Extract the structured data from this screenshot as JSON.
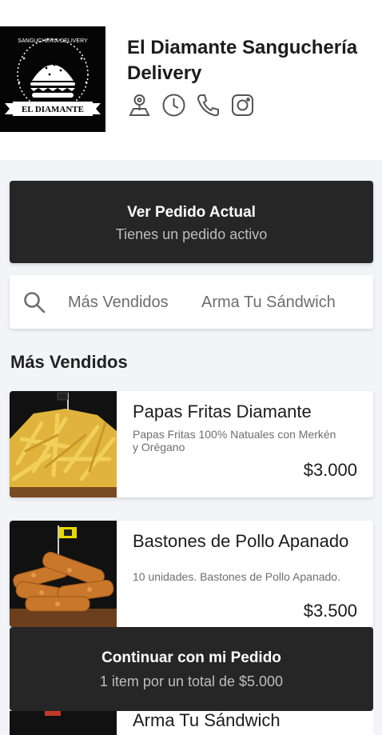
{
  "store": {
    "name": "El Diamante Sanguchería Delivery",
    "logo_top_text": "SANGUCHERIA DELIVERY",
    "logo_banner_text": "EL DIAMANTE",
    "icons": [
      "location-icon",
      "clock-icon",
      "phone-icon",
      "instagram-icon"
    ]
  },
  "order_button": {
    "title": "Ver Pedido Actual",
    "subtitle": "Tienes un pedido activo"
  },
  "search": {
    "tabs": [
      "Más Vendidos",
      "Arma Tu Sándwich"
    ]
  },
  "section": {
    "title": "Más Vendidos"
  },
  "products": [
    {
      "name": "Papas Fritas Diamante",
      "description": "Papas Fritas 100% Natuales con Merkén y Orégano",
      "price": "$3.000"
    },
    {
      "name": "Bastones de Pollo Apanado",
      "description": "10 unidades. Bastones de Pollo Apanado.",
      "price": "$3.500"
    },
    {
      "name": "Arma Tu Sándwich"
    }
  ],
  "continue_button": {
    "title": "Continuar con mi Pedido",
    "subtitle": "1 item por un total de $5.000"
  },
  "colors": {
    "dark_button": "#262626",
    "page_bg": "#f3f4f8",
    "muted_text": "#6d6d6d"
  }
}
